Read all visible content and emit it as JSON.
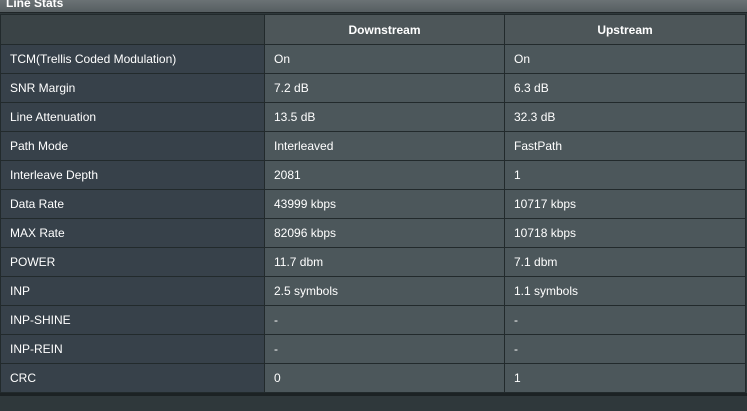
{
  "panel": {
    "title": "Line Stats"
  },
  "table": {
    "columns": [
      "",
      "Downstream",
      "Upstream"
    ],
    "rows": [
      {
        "label": "TCM(Trellis Coded Modulation)",
        "downstream": "On",
        "upstream": "On"
      },
      {
        "label": "SNR Margin",
        "downstream": "7.2 dB",
        "upstream": "6.3 dB"
      },
      {
        "label": "Line Attenuation",
        "downstream": "13.5 dB",
        "upstream": "32.3 dB"
      },
      {
        "label": "Path Mode",
        "downstream": "Interleaved",
        "upstream": "FastPath"
      },
      {
        "label": "Interleave Depth",
        "downstream": "2081",
        "upstream": "1"
      },
      {
        "label": "Data Rate",
        "downstream": "43999 kbps",
        "upstream": "10717 kbps"
      },
      {
        "label": "MAX Rate",
        "downstream": "82096 kbps",
        "upstream": "10718 kbps"
      },
      {
        "label": "POWER",
        "downstream": "11.7 dbm",
        "upstream": "7.1 dbm"
      },
      {
        "label": "INP",
        "downstream": "2.5 symbols",
        "upstream": "1.1 symbols"
      },
      {
        "label": "INP-SHINE",
        "downstream": "-",
        "upstream": "-"
      },
      {
        "label": "INP-REIN",
        "downstream": "-",
        "upstream": "-"
      },
      {
        "label": "CRC",
        "downstream": "0",
        "upstream": "1"
      }
    ]
  },
  "colors": {
    "background": "#2f383b",
    "header_cell": "#4d5659",
    "label_cell": "#37414a",
    "value_cell": "#4c575b",
    "text": "#ffffff"
  }
}
